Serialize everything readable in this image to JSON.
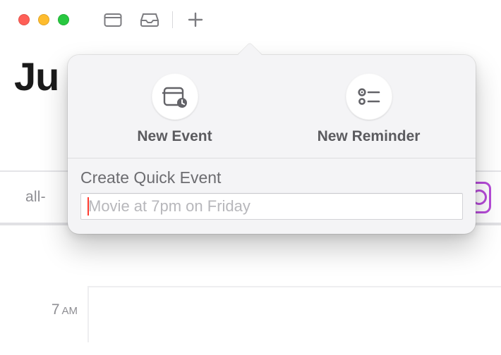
{
  "accent": "#ff3b30",
  "titlebar": {
    "icons": [
      "calendar-icon",
      "inbox-icon",
      "plus-icon"
    ]
  },
  "month_partial": "Ju",
  "allday": {
    "label": "all-",
    "overflow_left": "...",
    "overflow_right": "..."
  },
  "grid": {
    "hour_value": "7",
    "hour_meridiem": "AM"
  },
  "popover": {
    "new_event_label": "New Event",
    "new_reminder_label": "New Reminder",
    "quick_title": "Create Quick Event",
    "quick_placeholder": "Movie at 7pm on Friday",
    "quick_value": ""
  }
}
